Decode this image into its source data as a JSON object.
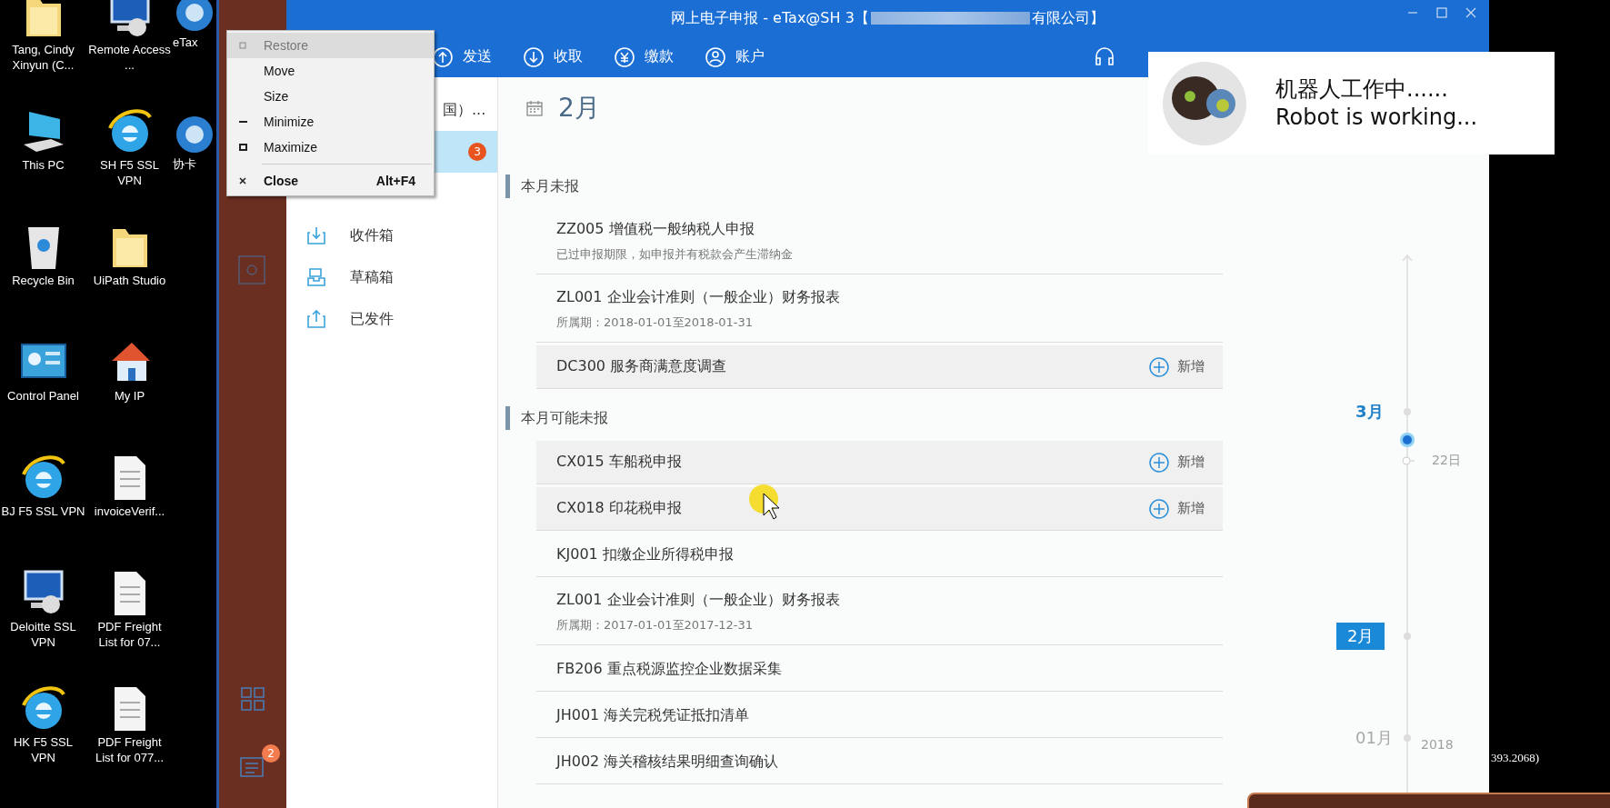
{
  "desktop": {
    "columns": [
      [
        {
          "label": "Tang, Cindy Xinyun (C...",
          "kind": "folder"
        },
        {
          "label": "This PC",
          "kind": "pc"
        },
        {
          "label": "Recycle Bin",
          "kind": "recycle"
        },
        {
          "label": "Control Panel",
          "kind": "control"
        },
        {
          "label": "BJ F5 SSL VPN",
          "kind": "ie"
        },
        {
          "label": "Deloitte SSL VPN",
          "kind": "remote"
        },
        {
          "label": "HK F5 SSL VPN",
          "kind": "ie"
        }
      ],
      [
        {
          "label": "Remote Access ...",
          "kind": "remote"
        },
        {
          "label": "SH F5 SSL VPN",
          "kind": "ie"
        },
        {
          "label": "UiPath Studio",
          "kind": "folder"
        },
        {
          "label": "My IP",
          "kind": "house"
        },
        {
          "label": "invoiceVerif...",
          "kind": "doc"
        },
        {
          "label": "PDF Freight List for 07...",
          "kind": "doc"
        },
        {
          "label": "PDF Freight List for 077...",
          "kind": "doc"
        }
      ],
      [
        {
          "label": "eTax",
          "kind": "etax"
        },
        {
          "label": "协卡",
          "kind": "etax"
        }
      ]
    ]
  },
  "window": {
    "title_start": "网上电子申报 - eTax@SH 3【",
    "title_end": "有限公司】"
  },
  "nav": [
    {
      "label": "发送",
      "kind": "send"
    },
    {
      "label": "收取",
      "kind": "receive"
    },
    {
      "label": "缴款",
      "kind": "pay"
    },
    {
      "label": "账户",
      "kind": "account"
    }
  ],
  "context_menu": [
    {
      "label": "Restore",
      "disabled": true,
      "selected": true,
      "default": false
    },
    {
      "label": "Move",
      "disabled": false,
      "selected": false,
      "default": false
    },
    {
      "label": "Size",
      "disabled": false,
      "selected": false,
      "default": false
    },
    {
      "label": "Minimize",
      "disabled": false,
      "selected": false,
      "default": false
    },
    {
      "label": "Maximize",
      "disabled": false,
      "selected": false,
      "default": false
    },
    {
      "label": "Close",
      "shortcut": "Alt+F4",
      "disabled": false,
      "selected": false,
      "default": true
    }
  ],
  "sidebar": {
    "badges": [
      "2"
    ]
  },
  "folders": [
    {
      "label": "国）...",
      "selected": false
    },
    {
      "badge": "3",
      "selected": true
    },
    {
      "label": "收件箱",
      "kind": "inbox",
      "selected": false
    },
    {
      "label": "草稿箱",
      "kind": "drafts",
      "selected": false
    },
    {
      "label": "已发件",
      "kind": "sent",
      "selected": false
    }
  ],
  "month_title": "2月",
  "sections": [
    {
      "title": "本月未报",
      "rows": [
        {
          "name": "ZZ005 增值税一般纳税人申报",
          "note": "已过申报期限，如申报并有税款会产生滞纳金"
        },
        {
          "name": "ZL001 企业会计准则（一般企业）财务报表",
          "note": "所属期：2018-01-01至2018-01-31"
        },
        {
          "name": "DC300 服务商满意度调查",
          "action": "新增"
        }
      ]
    },
    {
      "title": "本月可能未报",
      "rows": [
        {
          "name": "CX015 车船税申报",
          "action": "新增"
        },
        {
          "name": "CX018 印花税申报",
          "action": "新增"
        },
        {
          "name": "KJ001 扣缴企业所得税申报"
        },
        {
          "name": "ZL001 企业会计准则（一般企业）财务报表",
          "note": "所属期：2017-01-01至2017-12-31"
        },
        {
          "name": "FB206 重点税源监控企业数据采集"
        },
        {
          "name": "JH001 海关完税凭证抵扣清单"
        },
        {
          "name": "JH002 海关稽核结果明细查询确认"
        }
      ]
    }
  ],
  "timeline": [
    {
      "kind": "month",
      "label": "3月",
      "selected": false,
      "current": true
    },
    {
      "kind": "today",
      "label": "22日"
    },
    {
      "kind": "month",
      "label": "2月",
      "selected": true,
      "current": false
    },
    {
      "kind": "month",
      "label": "01月",
      "year": "2018",
      "selected": false,
      "current": false
    }
  ],
  "robot_popup": {
    "lines": [
      "机器人工作中......",
      "Robot is working..."
    ]
  },
  "background_text": "393.2068)"
}
